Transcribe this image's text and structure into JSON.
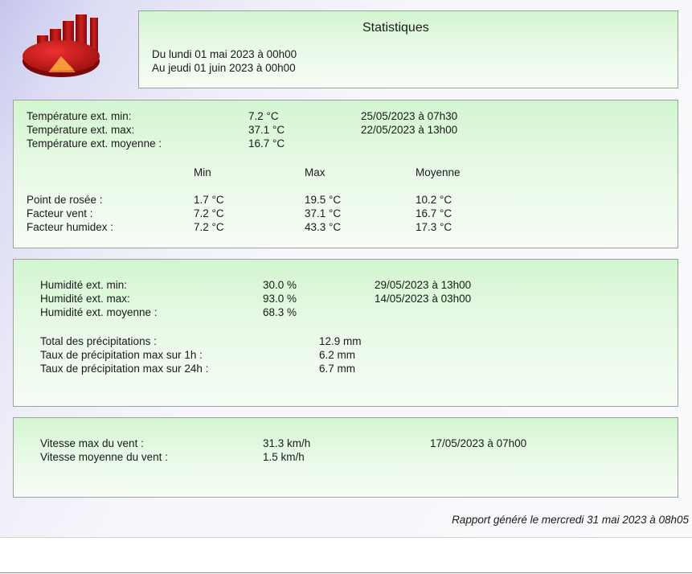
{
  "header": {
    "title": "Statistiques",
    "period_start": "Du lundi 01 mai 2023 à 00h00",
    "period_end": "Au jeudi 01 juin 2023 à 00h00"
  },
  "temperature": {
    "rows": [
      {
        "label": "Température ext. min:",
        "value": "7.2 °C",
        "date": "25/05/2023 à 07h30"
      },
      {
        "label": "Température ext. max:",
        "value": "37.1 °C",
        "date": "22/05/2023 à 13h00"
      },
      {
        "label": "Température ext. moyenne :",
        "value": "16.7 °C"
      }
    ],
    "columns": [
      "Min",
      "Max",
      "Moyenne"
    ],
    "table": [
      {
        "label": "Point de rosée :",
        "min": "1.7 °C",
        "max": "19.5 °C",
        "avg": "10.2 °C"
      },
      {
        "label": "Facteur vent :",
        "min": "7.2 °C",
        "max": "37.1 °C",
        "avg": "16.7 °C"
      },
      {
        "label": "Facteur humidex :",
        "min": "7.2 °C",
        "max": "43.3 °C",
        "avg": "17.3 °C"
      }
    ]
  },
  "humidity": {
    "rows": [
      {
        "label": "Humidité ext. min:",
        "value": "30.0 %",
        "date": "29/05/2023 à 13h00"
      },
      {
        "label": "Humidité ext. max:",
        "value": "93.0 %",
        "date": "14/05/2023 à 03h00"
      },
      {
        "label": "Humidité ext. moyenne :",
        "value": "68.3 %"
      }
    ],
    "precip": [
      {
        "label": "Total des précipitations :",
        "value": "12.9 mm"
      },
      {
        "label": "Taux de précipitation max sur 1h :",
        "value": "6.2 mm"
      },
      {
        "label": "Taux de précipitation max sur 24h :",
        "value": "6.7 mm"
      }
    ]
  },
  "wind": {
    "rows": [
      {
        "label": "Vitesse max du vent :",
        "value": "31.3 km/h",
        "date": "17/05/2023 à 07h00"
      },
      {
        "label": "Vitesse moyenne du vent :",
        "value": "1.5 km/h"
      }
    ]
  },
  "footer": "Rapport généré le mercredi 31 mai 2023 à 08h05",
  "icon": {
    "name": "statistics-chart-icon",
    "colors": {
      "red": "#cc1a1a",
      "dark_red": "#8a0a0a",
      "orange": "#f07020"
    }
  }
}
